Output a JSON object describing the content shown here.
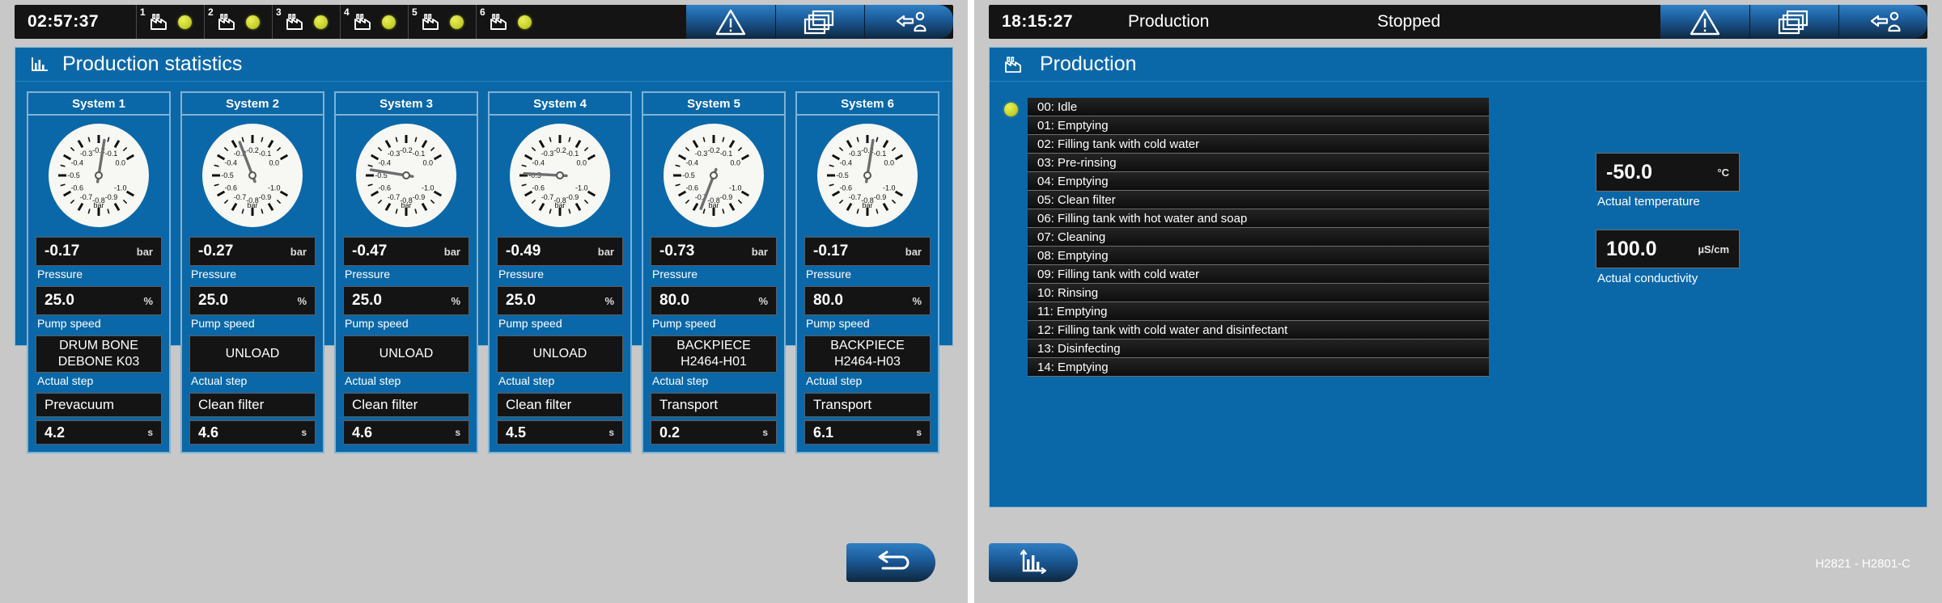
{
  "colors": {
    "panel_blue": "#0b68a8",
    "button_blue": "#1d5f9e",
    "lamp_green": "#ccd42e",
    "field_black": "#141414",
    "desktop_gray": "#c8c8c8"
  },
  "left_screen": {
    "topbar": {
      "clock": "02:57:37",
      "systems": [
        {
          "number": "1",
          "lamp": "green"
        },
        {
          "number": "2",
          "lamp": "green"
        },
        {
          "number": "3",
          "lamp": "green"
        },
        {
          "number": "4",
          "lamp": "green"
        },
        {
          "number": "5",
          "lamp": "green"
        },
        {
          "number": "6",
          "lamp": "green"
        }
      ],
      "buttons": [
        {
          "name": "alarm-button",
          "icon": "warning-triangle-icon"
        },
        {
          "name": "screens-button",
          "icon": "stacked-windows-icon"
        },
        {
          "name": "logout-button",
          "icon": "logout-user-icon"
        }
      ]
    },
    "panel": {
      "icon": "bar-chart-icon",
      "title": "Production statistics"
    },
    "labels": {
      "pressure": "Pressure",
      "pump_speed": "Pump speed",
      "actual_step": "Actual step",
      "unit_bar": "bar",
      "unit_percent": "%",
      "unit_seconds": "s"
    },
    "systems": [
      {
        "title": "System 1",
        "pressure": "-0.17",
        "pump_speed": "25.0",
        "recipe": [
          "DRUM BONE",
          "DEBONE K03"
        ],
        "step": "Prevacuum",
        "time": "4.2"
      },
      {
        "title": "System 2",
        "pressure": "-0.27",
        "pump_speed": "25.0",
        "recipe": [
          "UNLOAD"
        ],
        "step": "Clean filter",
        "time": "4.6"
      },
      {
        "title": "System 3",
        "pressure": "-0.47",
        "pump_speed": "25.0",
        "recipe": [
          "UNLOAD"
        ],
        "step": "Clean filter",
        "time": "4.6"
      },
      {
        "title": "System 4",
        "pressure": "-0.49",
        "pump_speed": "25.0",
        "recipe": [
          "UNLOAD"
        ],
        "step": "Clean filter",
        "time": "4.5"
      },
      {
        "title": "System 5",
        "pressure": "-0.73",
        "pump_speed": "80.0",
        "recipe": [
          "BACKPIECE",
          "H2464-H01"
        ],
        "step": "Transport",
        "time": "0.2"
      },
      {
        "title": "System 6",
        "pressure": "-0.17",
        "pump_speed": "80.0",
        "recipe": [
          "BACKPIECE",
          "H2464-H03"
        ],
        "step": "Transport",
        "time": "6.1"
      }
    ],
    "gauge": {
      "unit": "bar",
      "min": -1.0,
      "max": 0.0,
      "ticks": [
        "0.0",
        "-0.1",
        "-0.2",
        "-0.3",
        "-0.4",
        "-0.5",
        "-0.6",
        "-0.7",
        "-0.8",
        "-0.9",
        "-1.0"
      ]
    },
    "bottom_button": {
      "name": "back-button",
      "icon": "back-arrow-icon"
    }
  },
  "right_screen": {
    "topbar": {
      "clock": "18:15:27",
      "title": "Production",
      "state": "Stopped",
      "buttons": [
        {
          "name": "alarm-button",
          "icon": "warning-triangle-icon"
        },
        {
          "name": "screens-button",
          "icon": "stacked-windows-icon"
        },
        {
          "name": "logout-button",
          "icon": "logout-user-icon"
        }
      ]
    },
    "panel": {
      "icon": "factory-icon",
      "title": "Production"
    },
    "active_step_index": 0,
    "steps": [
      "00: Idle",
      "01: Emptying",
      "02: Filling tank with cold water",
      "03: Pre-rinsing",
      "04: Emptying",
      "05: Clean filter",
      "06: Filling tank with hot water and soap",
      "07: Cleaning",
      "08: Emptying",
      "09: Filling tank with cold water",
      "10: Rinsing",
      "11: Emptying",
      "12: Filling tank with cold water and disinfectant",
      "13: Disinfecting",
      "14: Emptying"
    ],
    "meters": [
      {
        "value": "-50.0",
        "unit": "°C",
        "label": "Actual temperature"
      },
      {
        "value": "100.0",
        "unit": "µS/cm",
        "label": "Actual conductivity"
      }
    ],
    "panel_id": "H2821 - H2801-C",
    "bottom_button": {
      "name": "statistics-button",
      "icon": "bar-chart-icon"
    }
  }
}
